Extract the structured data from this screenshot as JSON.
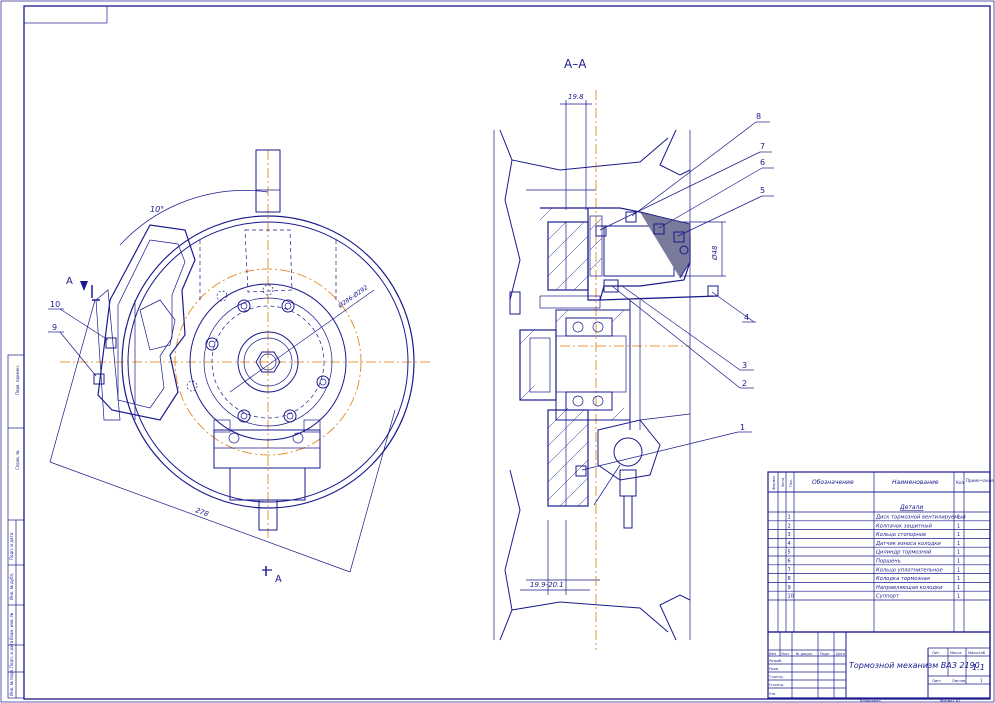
{
  "section_label": "A–A",
  "view_marks": {
    "top": "A",
    "bottom": "A"
  },
  "dimensions": {
    "angle": "10°",
    "diameter": "Ø286-Ø292",
    "length": "278",
    "top_width": "19.8",
    "bottom_width": "19.9-20.1",
    "bore": "Ø48"
  },
  "callouts": [
    "1",
    "2",
    "3",
    "4",
    "5",
    "6",
    "7",
    "8",
    "9",
    "10"
  ],
  "table": {
    "header": {
      "format": "Формат",
      "zone": "Зона",
      "pos": "Поз.",
      "designation": "Обозначение",
      "name": "Наименование",
      "qty": "Кол.",
      "note": "Приме-чание"
    },
    "section": "Детали",
    "rows": [
      {
        "pos": "1",
        "name": "Диск тормозной вентилируемый",
        "qty": "1"
      },
      {
        "pos": "2",
        "name": "Колпачок защитный",
        "qty": "1"
      },
      {
        "pos": "3",
        "name": "Кольцо стопорное",
        "qty": "1"
      },
      {
        "pos": "4",
        "name": "Датчик износа колодки",
        "qty": "1"
      },
      {
        "pos": "5",
        "name": "Цилиндр тормозной",
        "qty": "1"
      },
      {
        "pos": "6",
        "name": "Поршень",
        "qty": "1"
      },
      {
        "pos": "7",
        "name": "Кольцо уплотнительное",
        "qty": "1"
      },
      {
        "pos": "8",
        "name": "Колодка тормозная",
        "qty": "1"
      },
      {
        "pos": "9",
        "name": "Направляющая колодки",
        "qty": "1"
      },
      {
        "pos": "10",
        "name": "Суппорт",
        "qty": "1"
      }
    ]
  },
  "title_block": {
    "title": "Тормозной механизм ВАЗ 2190",
    "labels": {
      "change": "Изм",
      "sheet": "Лист",
      "doc": "№ докум.",
      "sign": "Подп.",
      "date": "Дата",
      "dev": "Разраб.",
      "check": "Пров.",
      "tcontrol": "Т.контр.",
      "ncontrol": "Н.контр.",
      "approved": "Утв.",
      "lit": "Лит.",
      "mass": "Масса",
      "scale": "Масштаб",
      "sheet2": "Лист",
      "sheets": "Листов"
    },
    "scale_value": "1:1",
    "sheets_value": "1",
    "copied": "Копировал",
    "format": "Формат  А1"
  },
  "side_stamp": [
    "Перв. примен.",
    "Справ. №",
    "Подп. и дата",
    "Инв. № дубл.",
    "Взам. инв. №",
    "Подп. и дата",
    "Инв. № подл."
  ]
}
